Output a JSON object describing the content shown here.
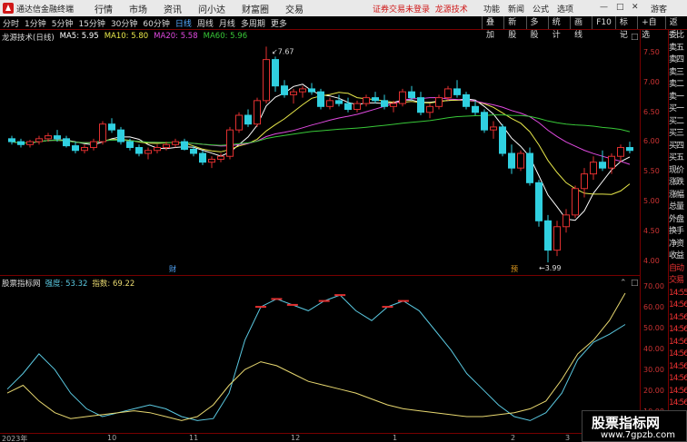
{
  "titlebar": {
    "app_name": "通达信金融终端",
    "menu": [
      "行情",
      "市场",
      "资讯",
      "问小达",
      "财富圈",
      "交易"
    ],
    "notice": "证券交易未登录",
    "brand": "龙源技术",
    "right_menu": [
      "功能",
      "新闻",
      "公式",
      "选项"
    ],
    "guest": "游客"
  },
  "toolbar": {
    "periods": [
      "分时",
      "1分钟",
      "5分钟",
      "15分钟",
      "30分钟",
      "60分钟",
      "日线",
      "周线",
      "月线",
      "多周期",
      "更多"
    ],
    "active_period": "日线",
    "tools": [
      "叠加",
      "新股",
      "多股",
      "统计",
      "画线",
      "F10",
      "标记",
      "+自选",
      "返回"
    ]
  },
  "main_panel": {
    "title": "龙源技术(日线)",
    "ma5": "MA5: 5.95",
    "ma10": "MA10: 5.80",
    "ma20": "MA20: 5.58",
    "ma60": "MA60: 5.96",
    "high_label": "7.67",
    "low_label": "3.99",
    "event_tag": "财",
    "event_tag2": "预",
    "y_ticks": [
      "7.50",
      "7.00",
      "6.50",
      "6.00",
      "5.50",
      "5.00",
      "4.50",
      "4.00"
    ],
    "colors": {
      "ma5": "#ffffff",
      "ma10": "#e8e84a",
      "ma20": "#e04ae0",
      "ma60": "#38c838",
      "up": "#e03030",
      "down": "#30d0e0"
    }
  },
  "indicator_panel": {
    "title": "股票指标网",
    "strength": "强度: 53.32",
    "index": "指数: 69.22",
    "y_ticks": [
      "70.00",
      "60.00",
      "50.00",
      "40.00",
      "30.00",
      "20.00",
      "10.00"
    ],
    "colors": {
      "strength": "#5ac8e0",
      "index": "#e8d870"
    }
  },
  "right_column": {
    "items": [
      "委比",
      "卖五",
      "卖四",
      "卖三",
      "卖二",
      "卖一",
      "买一",
      "买二",
      "买三",
      "买四",
      "买五",
      "现价",
      "涨跌",
      "涨幅",
      "总量",
      "外盘",
      "换手",
      "净资",
      "收益",
      "自动",
      "交易",
      "14:55",
      "14:56",
      "14:56",
      "14:56",
      "14:56",
      "14:56",
      "14:56",
      "14:56",
      "14:56",
      "14:56"
    ]
  },
  "time_axis": {
    "labels": [
      "2023年",
      "10",
      "11",
      "12",
      "1",
      "2",
      "3"
    ]
  },
  "watermark": {
    "big": "股票指标网",
    "small": "www.7gpzb.com"
  },
  "chart_data": [
    {
      "type": "candlestick",
      "title": "龙源技术(日线)",
      "ylim": [
        3.9,
        7.8
      ],
      "ohlc": [
        [
          6.1,
          6.15,
          6.0,
          6.05
        ],
        [
          6.05,
          6.1,
          5.95,
          6.0
        ],
        [
          6.0,
          6.08,
          5.95,
          6.05
        ],
        [
          6.05,
          6.15,
          6.0,
          6.1
        ],
        [
          6.1,
          6.2,
          6.05,
          6.15
        ],
        [
          6.15,
          6.25,
          6.05,
          6.1
        ],
        [
          6.1,
          6.15,
          5.95,
          5.98
        ],
        [
          5.98,
          6.05,
          5.85,
          5.9
        ],
        [
          5.9,
          6.0,
          5.85,
          5.95
        ],
        [
          5.95,
          6.1,
          5.9,
          6.05
        ],
        [
          6.05,
          6.4,
          6.0,
          6.35
        ],
        [
          6.35,
          6.45,
          6.2,
          6.25
        ],
        [
          6.25,
          6.3,
          6.0,
          6.05
        ],
        [
          6.05,
          6.1,
          5.9,
          5.95
        ],
        [
          5.95,
          6.0,
          5.8,
          5.85
        ],
        [
          5.85,
          5.95,
          5.75,
          5.9
        ],
        [
          5.9,
          6.0,
          5.85,
          5.95
        ],
        [
          5.95,
          6.05,
          5.9,
          6.0
        ],
        [
          6.0,
          6.1,
          5.95,
          6.05
        ],
        [
          6.05,
          6.1,
          5.9,
          5.92
        ],
        [
          5.92,
          5.98,
          5.8,
          5.85
        ],
        [
          5.85,
          5.9,
          5.65,
          5.7
        ],
        [
          5.7,
          5.8,
          5.6,
          5.75
        ],
        [
          5.75,
          5.85,
          5.7,
          5.8
        ],
        [
          5.8,
          6.3,
          5.75,
          6.25
        ],
        [
          6.25,
          6.55,
          6.2,
          6.5
        ],
        [
          6.5,
          6.6,
          6.3,
          6.35
        ],
        [
          6.35,
          6.8,
          6.3,
          6.75
        ],
        [
          6.75,
          7.67,
          6.7,
          7.45
        ],
        [
          7.45,
          7.5,
          6.9,
          7.0
        ],
        [
          7.0,
          7.1,
          6.8,
          6.85
        ],
        [
          6.85,
          6.95,
          6.7,
          6.9
        ],
        [
          6.9,
          7.0,
          6.8,
          6.95
        ],
        [
          6.95,
          7.05,
          6.85,
          6.9
        ],
        [
          6.9,
          6.95,
          6.6,
          6.65
        ],
        [
          6.65,
          6.8,
          6.6,
          6.75
        ],
        [
          6.75,
          6.85,
          6.65,
          6.7
        ],
        [
          6.7,
          6.8,
          6.55,
          6.6
        ],
        [
          6.6,
          6.75,
          6.55,
          6.7
        ],
        [
          6.7,
          6.85,
          6.65,
          6.8
        ],
        [
          6.8,
          6.9,
          6.7,
          6.75
        ],
        [
          6.75,
          6.85,
          6.6,
          6.65
        ],
        [
          6.65,
          6.75,
          6.55,
          6.7
        ],
        [
          6.7,
          6.95,
          6.65,
          6.9
        ],
        [
          6.9,
          7.0,
          6.75,
          6.8
        ],
        [
          6.8,
          6.9,
          6.5,
          6.55
        ],
        [
          6.55,
          6.7,
          6.45,
          6.65
        ],
        [
          6.65,
          6.85,
          6.6,
          6.8
        ],
        [
          6.8,
          7.0,
          6.75,
          6.95
        ],
        [
          6.95,
          7.1,
          6.8,
          6.85
        ],
        [
          6.85,
          6.9,
          6.6,
          6.65
        ],
        [
          6.65,
          6.75,
          6.5,
          6.55
        ],
        [
          6.55,
          6.6,
          6.2,
          6.25
        ],
        [
          6.25,
          6.4,
          6.1,
          6.3
        ],
        [
          6.3,
          6.35,
          5.8,
          5.85
        ],
        [
          5.85,
          6.0,
          5.5,
          5.6
        ],
        [
          5.6,
          5.9,
          5.55,
          5.85
        ],
        [
          5.85,
          5.95,
          5.3,
          5.35
        ],
        [
          5.35,
          5.4,
          4.6,
          4.7
        ],
        [
          4.7,
          4.8,
          3.99,
          4.2
        ],
        [
          4.2,
          4.7,
          4.1,
          4.6
        ],
        [
          4.6,
          4.9,
          4.5,
          4.8
        ],
        [
          4.8,
          5.3,
          4.75,
          5.25
        ],
        [
          5.25,
          5.6,
          5.1,
          5.5
        ],
        [
          5.5,
          5.8,
          5.4,
          5.7
        ],
        [
          5.7,
          5.9,
          5.55,
          5.6
        ],
        [
          5.6,
          5.85,
          5.5,
          5.8
        ],
        [
          5.8,
          6.0,
          5.7,
          5.95
        ],
        [
          5.95,
          6.05,
          5.85,
          5.9
        ]
      ]
    },
    {
      "type": "line",
      "title": "股票指标网",
      "ylim": [
        0,
        75
      ],
      "series": [
        {
          "name": "强度",
          "values": [
            20,
            28,
            38,
            30,
            18,
            10,
            6,
            8,
            10,
            12,
            10,
            6,
            4,
            5,
            18,
            45,
            62,
            66,
            63,
            60,
            65,
            68,
            60,
            55,
            62,
            65,
            60,
            50,
            40,
            28,
            20,
            12,
            6,
            4,
            8,
            18,
            35,
            44,
            48,
            53
          ]
        },
        {
          "name": "指数",
          "values": [
            18,
            22,
            14,
            8,
            5,
            6,
            7,
            8,
            9,
            8,
            6,
            4,
            6,
            12,
            22,
            30,
            34,
            32,
            28,
            24,
            22,
            20,
            18,
            15,
            12,
            10,
            9,
            8,
            7,
            6,
            6,
            7,
            8,
            10,
            14,
            25,
            38,
            45,
            55,
            69
          ]
        }
      ]
    }
  ]
}
